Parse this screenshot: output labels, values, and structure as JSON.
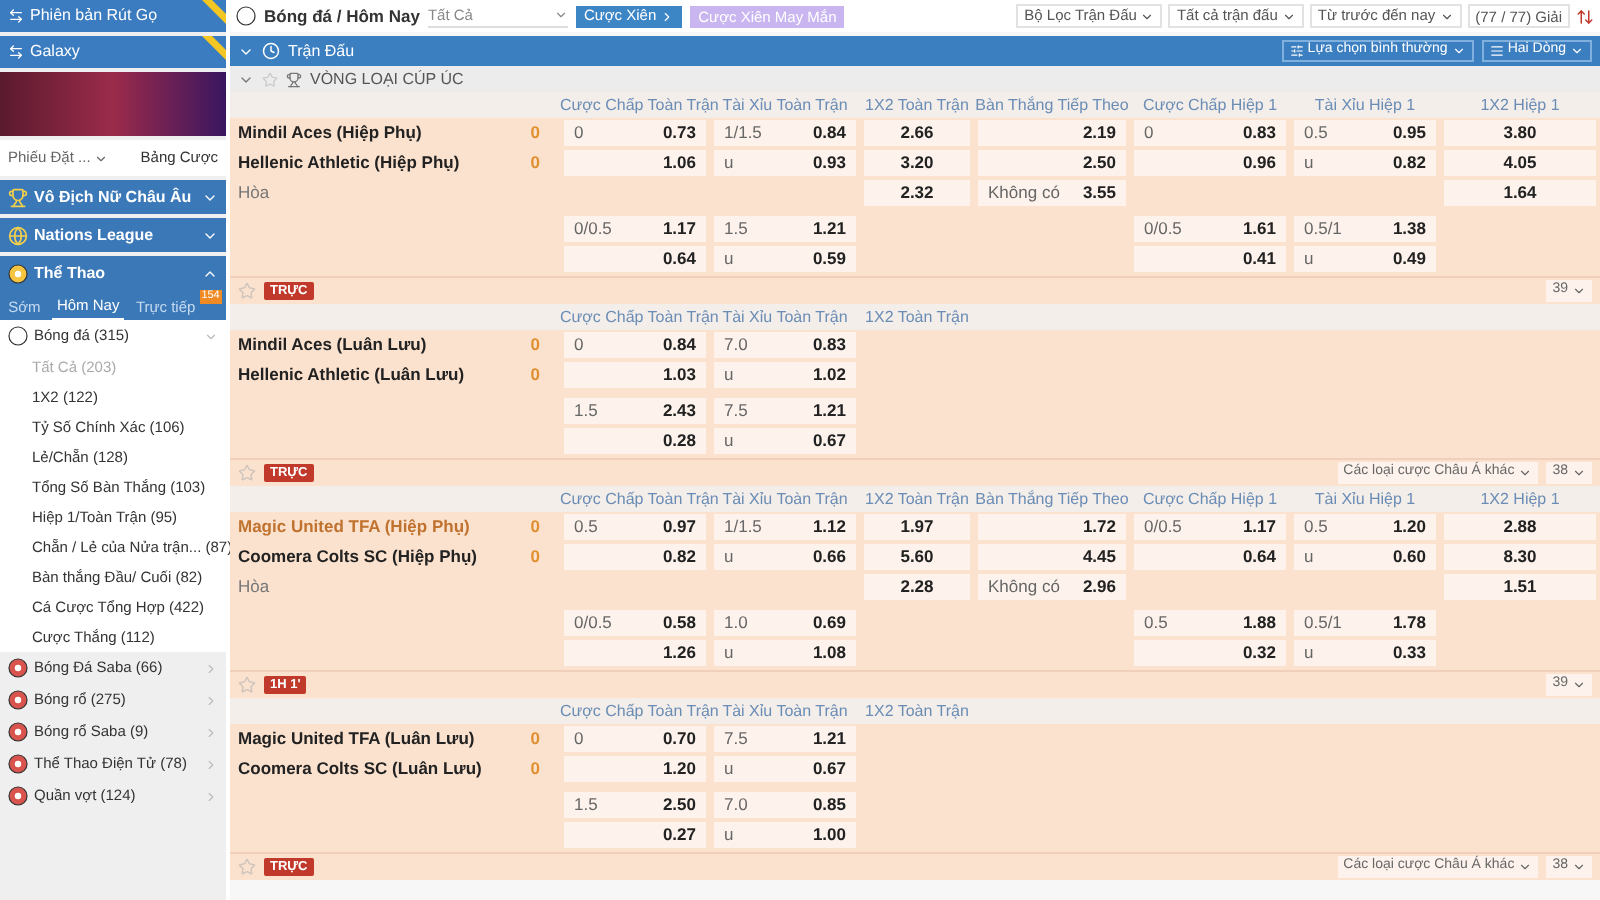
{
  "sidebar": {
    "version_buttons": [
      {
        "label": "Phiên bản Rút Gọ"
      },
      {
        "label": "Galaxy"
      }
    ],
    "bet_slip_select": "Phiếu Đặt ...",
    "odds_table_tab": "Bảng Cược",
    "sections": [
      {
        "name": "Vô Địch Nữ Châu Âu",
        "expanded": false
      },
      {
        "name": "Nations League",
        "expanded": false
      },
      {
        "name": "Thể Thao",
        "expanded": true
      }
    ],
    "period_tabs": [
      {
        "label": "Sớm",
        "selected": false
      },
      {
        "label": "Hôm Nay",
        "selected": true
      },
      {
        "label": "Trực tiếp",
        "selected": false,
        "badge": "154"
      }
    ],
    "sports": [
      {
        "label": "Bóng đá (315)",
        "expanded": true,
        "children": [
          {
            "label": "Tất Cả",
            "count": "(203)",
            "selected": true
          },
          {
            "label": "1X2",
            "count": "(122)",
            "selected": false
          },
          {
            "label": "Tỷ Số Chính Xác",
            "count": "(106)",
            "selected": false
          },
          {
            "label": "Lẻ/Chẵn",
            "count": "(128)",
            "selected": false
          },
          {
            "label": "Tổng Số Bàn Thắng",
            "count": "(103)",
            "selected": false
          },
          {
            "label": "Hiệp 1/Toàn Trận",
            "count": "(95)",
            "selected": false
          },
          {
            "label": "Chẵn / Lẻ của Nửa trận...",
            "count": "(87)",
            "selected": false
          },
          {
            "label": "Bàn thắng Đầu/ Cuối",
            "count": "(82)",
            "selected": false
          },
          {
            "label": "Cá Cược Tổng Hợp",
            "count": "(422)",
            "selected": false
          },
          {
            "label": "Cược Thắng",
            "count": "(112)",
            "selected": false
          }
        ]
      },
      {
        "label": "Bóng Đá Saba (66)",
        "expanded": false
      },
      {
        "label": "Bóng rổ (275)",
        "expanded": false
      },
      {
        "label": "Bóng rổ Saba (9)",
        "expanded": false
      },
      {
        "label": "Thể Thao Điện Tử (78)",
        "expanded": false
      },
      {
        "label": "Quần vợt (124)",
        "expanded": false
      }
    ]
  },
  "top_bar": {
    "breadcrumb": "Bóng đá / Hôm Nay",
    "market_select": "Tất Cả",
    "parlay_button": "Cược Xiên",
    "lucky_parlay_button": "Cược Xiên May Mắn",
    "filters": [
      "Bộ Lọc Trận Đấu",
      "Tất cả trận đấu",
      "Từ trước đến nay"
    ],
    "league_count": "(77 / 77) Giải"
  },
  "section_bar": {
    "title": "Trận Đấu",
    "view_select": "Lựa chọn bình thường",
    "rows_select": "Hai Dòng"
  },
  "league": {
    "name": "VÒNG LOẠI CÚP ÚC"
  },
  "matches": [
    {
      "headers": [
        "Cược Chấp Toàn Trận",
        "Tài Xỉu Toàn Trận",
        "1X2 Toàn Trận",
        "Bàn Thắng Tiếp Theo",
        "Cược Chấp Hiệp 1",
        "Tài Xỉu Hiệp 1",
        "1X2 Hiệp 1"
      ],
      "rows": [
        {
          "kind": "team",
          "name": "Mindil Aces (Hiệp Phụ)",
          "score": "0",
          "favorite": false,
          "cells": {
            "ah_ft": {
              "line": "0",
              "odds": "0.73"
            },
            "ou_ft": {
              "line": "1/1.5",
              "odds": "0.84"
            },
            "x12_ft": {
              "odds": "2.66"
            },
            "next_goal": {
              "odds": "2.19"
            },
            "ah_h1": {
              "line": "0",
              "odds": "0.83"
            },
            "ou_h1": {
              "line": "0.5",
              "odds": "0.95"
            },
            "x12_h1": {
              "odds": "3.80"
            }
          }
        },
        {
          "kind": "team",
          "name": "Hellenic Athletic (Hiệp Phụ)",
          "score": "0",
          "favorite": false,
          "cells": {
            "ah_ft": {
              "odds": "1.06"
            },
            "ou_ft": {
              "line": "u",
              "odds": "0.93"
            },
            "x12_ft": {
              "odds": "3.20"
            },
            "next_goal": {
              "odds": "2.50"
            },
            "ah_h1": {
              "odds": "0.96"
            },
            "ou_h1": {
              "line": "u",
              "odds": "0.82"
            },
            "x12_h1": {
              "odds": "4.05"
            }
          }
        },
        {
          "kind": "draw",
          "name": "Hòa",
          "cells": {
            "x12_ft": {
              "odds": "2.32"
            },
            "next_goal": {
              "line": "Không có",
              "odds": "3.55"
            },
            "x12_h1": {
              "odds": "1.64"
            }
          }
        },
        {
          "kind": "line",
          "cells": {
            "ah_ft": {
              "line": "0/0.5",
              "odds": "1.17"
            },
            "ou_ft": {
              "line": "1.5",
              "odds": "1.21"
            },
            "ah_h1": {
              "line": "0/0.5",
              "odds": "1.61"
            },
            "ou_h1": {
              "line": "0.5/1",
              "odds": "1.38"
            }
          }
        },
        {
          "kind": "line",
          "cells": {
            "ah_ft": {
              "odds": "0.64"
            },
            "ou_ft": {
              "line": "u",
              "odds": "0.59"
            },
            "ah_h1": {
              "odds": "0.41"
            },
            "ou_h1": {
              "line": "u",
              "odds": "0.49"
            }
          }
        }
      ],
      "footer": {
        "tag": "TRỰC",
        "count": "39"
      }
    },
    {
      "headers": [
        "Cược Chấp Toàn Trận",
        "Tài Xỉu Toàn Trận",
        "1X2 Toàn Trận"
      ],
      "rows": [
        {
          "kind": "team",
          "name": "Mindil Aces (Luân Lưu)",
          "score": "0",
          "favorite": false,
          "cells": {
            "ah_ft": {
              "line": "0",
              "odds": "0.84"
            },
            "ou_ft": {
              "line": "7.0",
              "odds": "0.83"
            }
          }
        },
        {
          "kind": "team",
          "name": "Hellenic Athletic (Luân Lưu)",
          "score": "0",
          "favorite": false,
          "cells": {
            "ah_ft": {
              "odds": "1.03"
            },
            "ou_ft": {
              "line": "u",
              "odds": "1.02"
            }
          }
        },
        {
          "kind": "line",
          "cells": {
            "ah_ft": {
              "line": "1.5",
              "odds": "2.43"
            },
            "ou_ft": {
              "line": "7.5",
              "odds": "1.21"
            }
          }
        },
        {
          "kind": "line",
          "cells": {
            "ah_ft": {
              "odds": "0.28"
            },
            "ou_ft": {
              "line": "u",
              "odds": "0.67"
            }
          }
        }
      ],
      "footer": {
        "tag": "TRỰC",
        "menu": "Các loại cược Châu Á khác",
        "count": "38"
      }
    },
    {
      "headers": [
        "Cược Chấp Toàn Trận",
        "Tài Xỉu Toàn Trận",
        "1X2 Toàn Trận",
        "Bàn Thắng Tiếp Theo",
        "Cược Chấp Hiệp 1",
        "Tài Xỉu Hiệp 1",
        "1X2 Hiệp 1"
      ],
      "rows": [
        {
          "kind": "team",
          "name": "Magic United TFA (Hiệp Phụ)",
          "score": "0",
          "favorite": true,
          "cells": {
            "ah_ft": {
              "line": "0.5",
              "odds": "0.97"
            },
            "ou_ft": {
              "line": "1/1.5",
              "odds": "1.12"
            },
            "x12_ft": {
              "odds": "1.97"
            },
            "next_goal": {
              "odds": "1.72"
            },
            "ah_h1": {
              "line": "0/0.5",
              "odds": "1.17"
            },
            "ou_h1": {
              "line": "0.5",
              "odds": "1.20"
            },
            "x12_h1": {
              "odds": "2.88"
            }
          }
        },
        {
          "kind": "team",
          "name": "Coomera Colts SC (Hiệp Phụ)",
          "score": "0",
          "favorite": false,
          "cells": {
            "ah_ft": {
              "odds": "0.82"
            },
            "ou_ft": {
              "line": "u",
              "odds": "0.66"
            },
            "x12_ft": {
              "odds": "5.60"
            },
            "next_goal": {
              "odds": "4.45"
            },
            "ah_h1": {
              "odds": "0.64"
            },
            "ou_h1": {
              "line": "u",
              "odds": "0.60"
            },
            "x12_h1": {
              "odds": "8.30"
            }
          }
        },
        {
          "kind": "draw",
          "name": "Hòa",
          "cells": {
            "x12_ft": {
              "odds": "2.28"
            },
            "next_goal": {
              "line": "Không có",
              "odds": "2.96"
            },
            "x12_h1": {
              "odds": "1.51"
            }
          }
        },
        {
          "kind": "line",
          "cells": {
            "ah_ft": {
              "line": "0/0.5",
              "odds": "0.58"
            },
            "ou_ft": {
              "line": "1.0",
              "odds": "0.69"
            },
            "ah_h1": {
              "line": "0.5",
              "odds": "1.88"
            },
            "ou_h1": {
              "line": "0.5/1",
              "odds": "1.78"
            }
          }
        },
        {
          "kind": "line",
          "cells": {
            "ah_ft": {
              "odds": "1.26"
            },
            "ou_ft": {
              "line": "u",
              "odds": "1.08"
            },
            "ah_h1": {
              "odds": "0.32"
            },
            "ou_h1": {
              "line": "u",
              "odds": "0.33"
            }
          }
        }
      ],
      "footer": {
        "tag": "1H 1'",
        "count": "39"
      }
    },
    {
      "headers": [
        "Cược Chấp Toàn Trận",
        "Tài Xỉu Toàn Trận",
        "1X2 Toàn Trận"
      ],
      "rows": [
        {
          "kind": "team",
          "name": "Magic United TFA (Luân Lưu)",
          "score": "0",
          "favorite": false,
          "cells": {
            "ah_ft": {
              "line": "0",
              "odds": "0.70"
            },
            "ou_ft": {
              "line": "7.5",
              "odds": "1.21"
            }
          }
        },
        {
          "kind": "team",
          "name": "Coomera Colts SC (Luân Lưu)",
          "score": "0",
          "favorite": false,
          "cells": {
            "ah_ft": {
              "odds": "1.20"
            },
            "ou_ft": {
              "line": "u",
              "odds": "0.67"
            }
          }
        },
        {
          "kind": "line",
          "cells": {
            "ah_ft": {
              "line": "1.5",
              "odds": "2.50"
            },
            "ou_ft": {
              "line": "7.0",
              "odds": "0.85"
            }
          }
        },
        {
          "kind": "line",
          "cells": {
            "ah_ft": {
              "odds": "0.27"
            },
            "ou_ft": {
              "line": "u",
              "odds": "1.00"
            }
          }
        }
      ],
      "footer": {
        "tag": "TRỰC",
        "menu": "Các loại cược Châu Á khác",
        "count": "38"
      }
    }
  ]
}
